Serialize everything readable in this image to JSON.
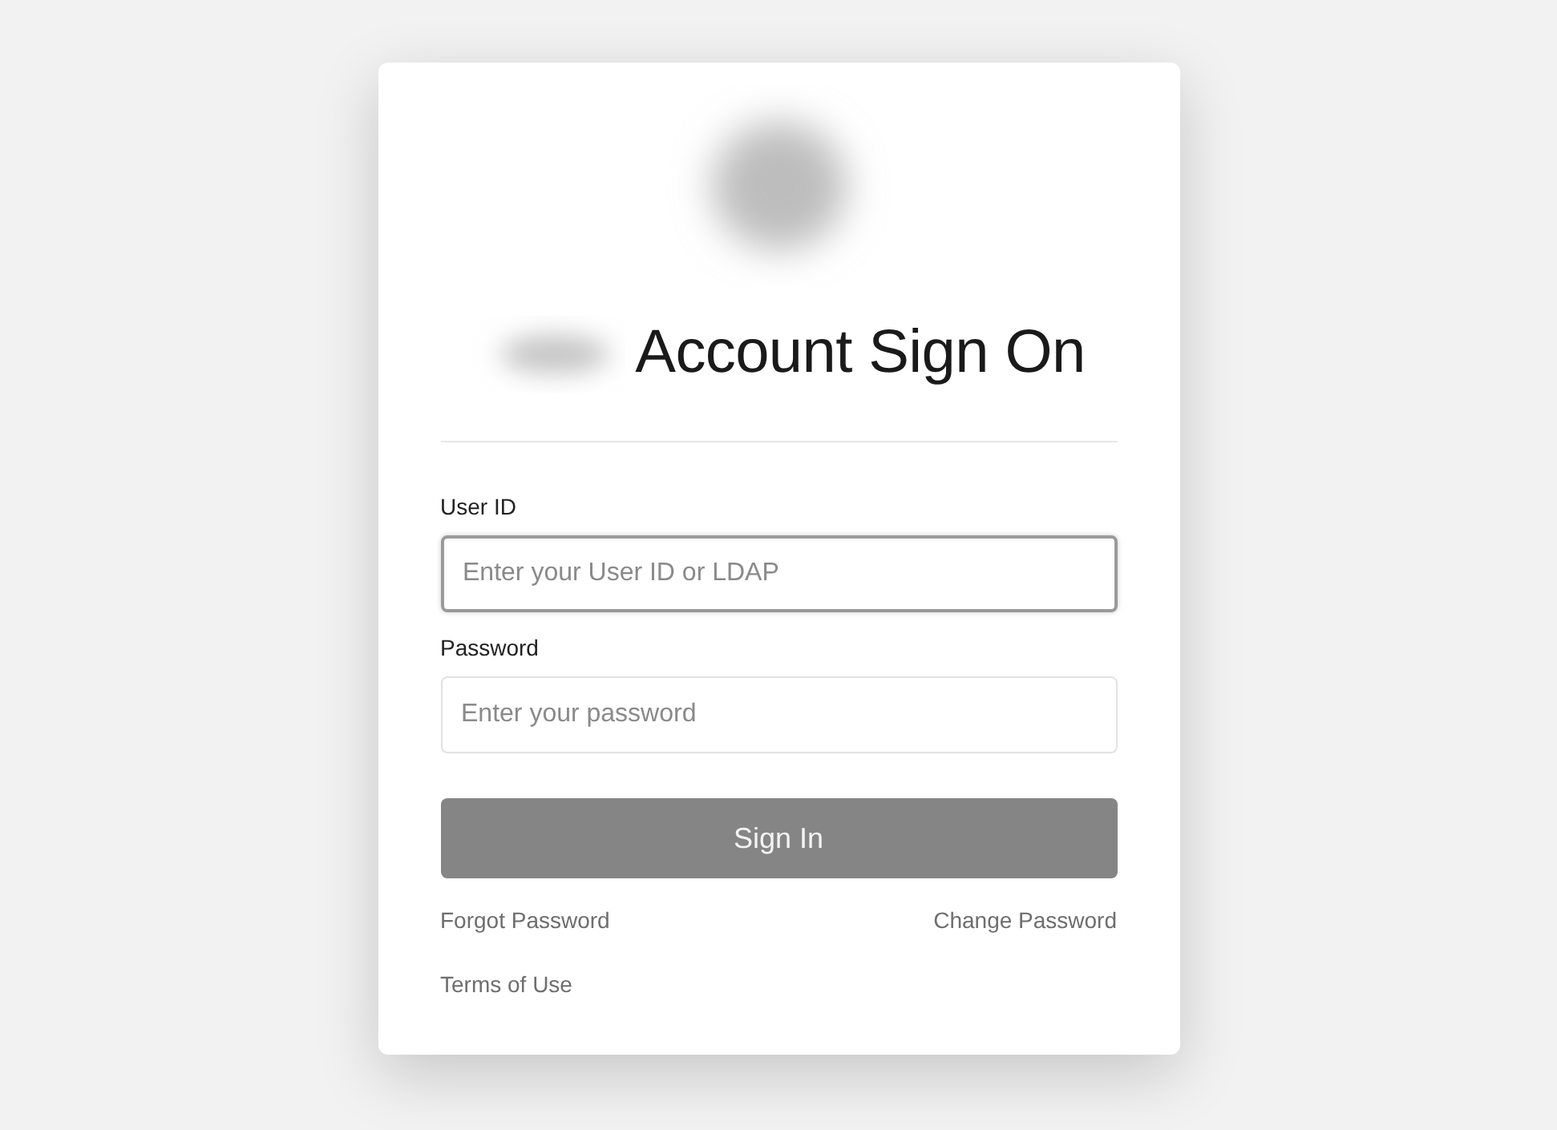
{
  "title": "Account Sign On",
  "fields": [
    {
      "label": "User ID",
      "placeholder": "Enter your User ID or LDAP",
      "focused": true
    },
    {
      "label": "Password",
      "placeholder": "Enter your password",
      "focused": false
    }
  ],
  "submit": "Sign In",
  "link_rows": [
    [
      "Forgot Password",
      "Change Password"
    ],
    [
      "Terms of Use"
    ]
  ]
}
